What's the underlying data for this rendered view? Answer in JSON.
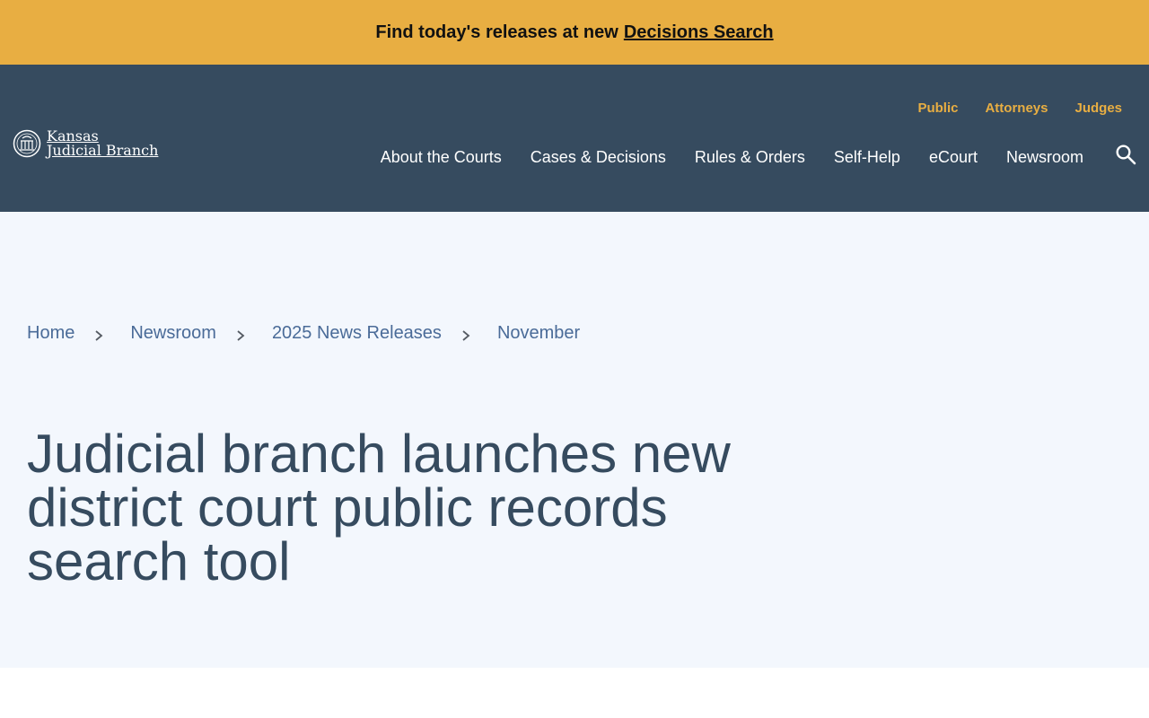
{
  "alert": {
    "text": "Find today's releases at new",
    "link_label": "Decisions Search",
    "bg_color": "#e8ae42"
  },
  "header": {
    "bg_color": "#364b5f",
    "logo": {
      "line1": "Kansas",
      "line2": "Judicial Branch",
      "icon": "state-seal-icon"
    },
    "utility_nav": [
      {
        "label": "Public"
      },
      {
        "label": "Attorneys"
      },
      {
        "label": "Judges"
      }
    ],
    "main_nav": [
      {
        "label": "About the Courts"
      },
      {
        "label": "Cases & Decisions"
      },
      {
        "label": "Rules & Orders"
      },
      {
        "label": "Self-Help"
      },
      {
        "label": "eCourt"
      },
      {
        "label": "Newsroom"
      }
    ],
    "search_icon": "search-icon",
    "accent_color": "#e8ae42"
  },
  "breadcrumb": [
    {
      "label": "Home"
    },
    {
      "label": "Newsroom"
    },
    {
      "label": "2025 News Releases"
    },
    {
      "label": "November"
    }
  ],
  "page": {
    "title": "Judicial branch launches new district court public records search tool"
  }
}
